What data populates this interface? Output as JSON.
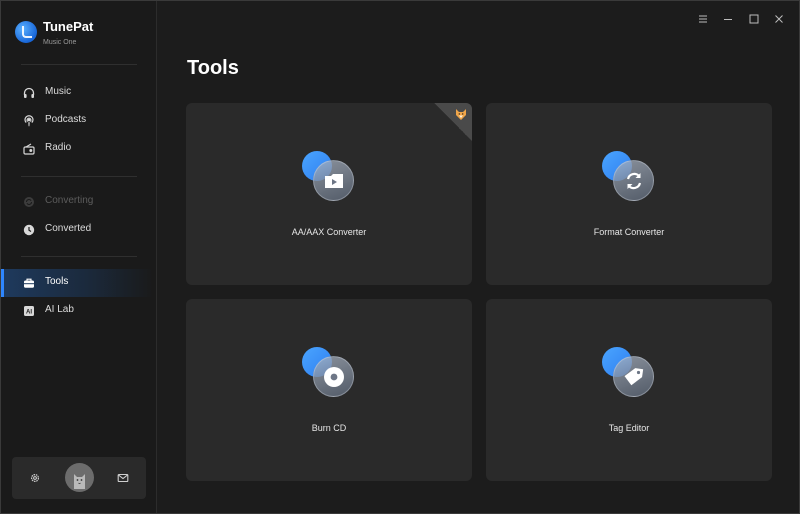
{
  "app": {
    "name": "TunePat",
    "subtitle": "Music One"
  },
  "sidebar": {
    "items": [
      {
        "label": "Music",
        "icon": "headphones-icon",
        "state": "normal"
      },
      {
        "label": "Podcasts",
        "icon": "podcast-icon",
        "state": "normal"
      },
      {
        "label": "Radio",
        "icon": "radio-icon",
        "state": "normal"
      },
      {
        "label": "Converting",
        "icon": "converting-icon",
        "state": "disabled"
      },
      {
        "label": "Converted",
        "icon": "clock-icon",
        "state": "normal"
      },
      {
        "label": "Tools",
        "icon": "toolbox-icon",
        "state": "active"
      },
      {
        "label": "AI Lab",
        "icon": "ai-icon",
        "state": "normal"
      }
    ],
    "bottom": {
      "settings_icon": "gear-icon",
      "avatar_icon": "cat-avatar",
      "mail_icon": "mail-icon"
    }
  },
  "window_controls": [
    "menu-icon",
    "minimize-icon",
    "maximize-icon",
    "close-icon"
  ],
  "main": {
    "title": "Tools",
    "tools": [
      {
        "label": "AA/AAX Converter",
        "icon": "video-play-icon",
        "badge": "fox-badge-icon"
      },
      {
        "label": "Format Converter",
        "icon": "refresh-icon"
      },
      {
        "label": "Burn CD",
        "icon": "disc-icon"
      },
      {
        "label": "Tag Editor",
        "icon": "tag-icon"
      }
    ]
  },
  "colors": {
    "accent": "#2e86ff",
    "background": "#1c1c1c",
    "card": "#2a2a2a",
    "sidebar": "#1a1a1a"
  }
}
